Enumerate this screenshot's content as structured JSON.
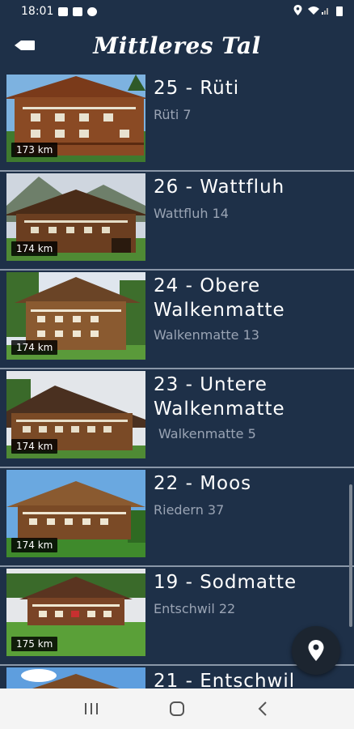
{
  "status_bar": {
    "time": "18:01"
  },
  "app_bar": {
    "title": "Mittleres Tal"
  },
  "farms": [
    {
      "title": "25 - Rüti",
      "address": "Rüti 7",
      "distance": "173 km"
    },
    {
      "title": "26 - Wattfluh",
      "address": "Wattfluh 14",
      "distance": "174 km"
    },
    {
      "title": "24 - Obere Walkenmatte",
      "address": "Walkenmatte 13",
      "distance": "174 km"
    },
    {
      "title": "23 - Untere Walkenmatte",
      "address": "Walkenmatte 5",
      "distance": "174 km"
    },
    {
      "title": "22 - Moos",
      "address": "Riedern 37",
      "distance": "174 km"
    },
    {
      "title": "19 - Sodmatte",
      "address": "Entschwil 22",
      "distance": "175 km"
    },
    {
      "title": "21 - Entschwil",
      "address": "",
      "distance": ""
    }
  ],
  "colors": {
    "background": "#1e3048",
    "divider": "#8a97a8",
    "subtitle": "#9aa4b4",
    "fab": "#1c2530"
  },
  "icons": {
    "back": "back-arrow-icon",
    "map_fab": "map-pin-icon"
  }
}
